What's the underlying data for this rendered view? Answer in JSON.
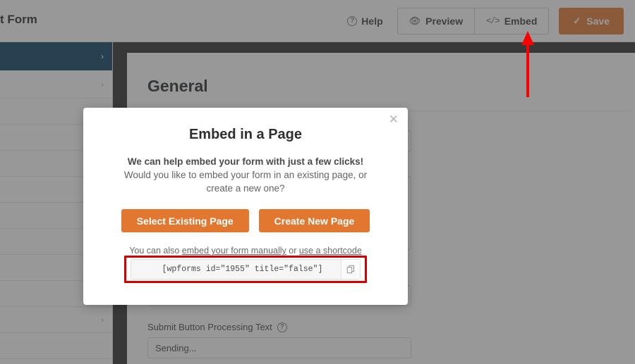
{
  "toolbar": {
    "form_title": "ntact Form",
    "help_label": "Help",
    "help_icon": "question-circle-icon",
    "preview_label": "Preview",
    "preview_icon": "eye-icon",
    "embed_label": "Embed",
    "embed_icon": "code-brackets-icon",
    "save_label": "Save",
    "save_icon": "check-icon",
    "save_color": "#e27730"
  },
  "sidebar": {
    "items": [
      {
        "label": "",
        "chevron": "›",
        "active": true
      },
      {
        "label": "",
        "chevron": "›",
        "active": false
      },
      {
        "label": "",
        "chevron": "",
        "active": false
      },
      {
        "label": "",
        "chevron": "",
        "active": false
      },
      {
        "label": "",
        "chevron": "",
        "active": false
      },
      {
        "label": "",
        "chevron": "",
        "active": false
      },
      {
        "label": "",
        "chevron": "",
        "active": false
      },
      {
        "label": "",
        "chevron": "",
        "active": false
      },
      {
        "label": "",
        "chevron": "",
        "active": false
      },
      {
        "label": "",
        "chevron": "",
        "active": false
      },
      {
        "label": "",
        "chevron": "›",
        "active": false
      },
      {
        "label": "",
        "chevron": "",
        "active": false
      }
    ]
  },
  "panel": {
    "heading": "General",
    "fields": [
      {
        "label": "",
        "value": ""
      },
      {
        "label": "",
        "value": ""
      },
      {
        "label": "Submit Button Processing Text",
        "value": "Sending...",
        "help_icon": "question-circle-icon"
      }
    ]
  },
  "modal": {
    "close_icon": "close-icon",
    "title": "Embed in a Page",
    "subtitle_line1": "We can help embed your form with just a few clicks!",
    "subtitle_line2": "Would you like to embed your form in an existing page, or",
    "subtitle_line3": "create a new one?",
    "select_existing_label": "Select Existing Page",
    "create_new_label": "Create New Page",
    "manual_prefix": "You can also ",
    "manual_link1": "embed your form manually",
    "manual_middle": " or ",
    "manual_link2": "use a shortcode",
    "shortcode": "[wpforms id=\"1955\" title=\"false\"]",
    "copy_icon": "copy-icon",
    "button_color": "#e27730",
    "highlight_color": "#d60000"
  },
  "annotation": {
    "arrow_icon": "up-arrow-annotation",
    "arrow_color": "#ff0000",
    "points_to": "Embed"
  }
}
